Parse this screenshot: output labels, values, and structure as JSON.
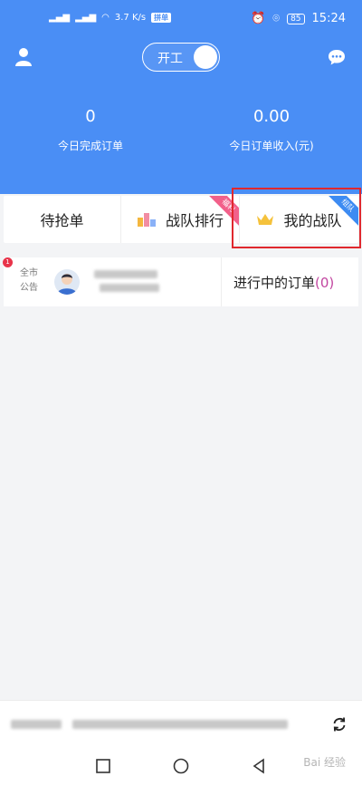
{
  "status_bar": {
    "net_speed": "3.7 K/s",
    "app_chip": "拼单",
    "battery": "85",
    "time": "15:24"
  },
  "header": {
    "toggle_label": "开工",
    "stats": [
      {
        "value": "0",
        "label": "今日完成订单"
      },
      {
        "value": "0.00",
        "label": "今日订单收入(元)"
      }
    ]
  },
  "tabs": [
    {
      "label": "待抢单",
      "icon": "none",
      "ribbon": ""
    },
    {
      "label": "战队排行",
      "icon": "ranking-blocks-icon",
      "ribbon": "福利"
    },
    {
      "label": "我的战队",
      "icon": "crown-icon",
      "ribbon": "组队"
    }
  ],
  "notice": {
    "badge": "1",
    "tag": "全市公告",
    "in_progress_label": "进行中的订单",
    "in_progress_count": "(0)"
  },
  "watermark": "Bai 经验",
  "colors": {
    "header_blue": "#4a8ef5",
    "highlight_red": "#e0282e",
    "count_purple": "#c246a0"
  }
}
